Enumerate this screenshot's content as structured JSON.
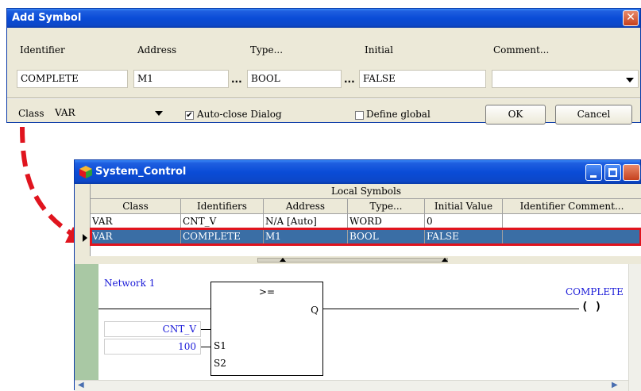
{
  "dialog": {
    "title": "Add Symbol",
    "headers": {
      "identifier": "Identifier",
      "address": "Address",
      "type": "Type...",
      "initial": "Initial",
      "comment": "Comment..."
    },
    "fields": {
      "identifier": "COMPLETE",
      "address": "M1",
      "type": "BOOL",
      "initial": "FALSE",
      "comment": ""
    },
    "browse_label": "...",
    "class_label": "Class",
    "class_value": "VAR",
    "auto_close_label": "Auto-close Dialog",
    "auto_close_checked": "✔",
    "define_global_label": "Define global",
    "ok_label": "OK",
    "cancel_label": "Cancel"
  },
  "window": {
    "title": "System_Control",
    "grid_title": "Local Symbols",
    "columns": [
      "Class",
      "Identifiers",
      "Address",
      "Type...",
      "Initial Value",
      "Identifier Comment..."
    ],
    "rows": [
      [
        "VAR",
        "CNT_V",
        "N/A [Auto]",
        "WORD",
        "0",
        ""
      ],
      [
        "VAR",
        "COMPLETE",
        "M1",
        "BOOL",
        "FALSE",
        ""
      ]
    ],
    "network_label": "Network 1",
    "block_op": ">=",
    "pin_q": "Q",
    "pin_s1": "S1",
    "pin_s2": "S2",
    "input_s1": "CNT_V",
    "input_s2": "100",
    "coil_label": "COMPLETE",
    "coil_symbol": "(  )"
  },
  "colors": {
    "highlight": "#e0141e",
    "selected_row": "#3a6ea5",
    "title_bar": "#0a4cd7"
  }
}
